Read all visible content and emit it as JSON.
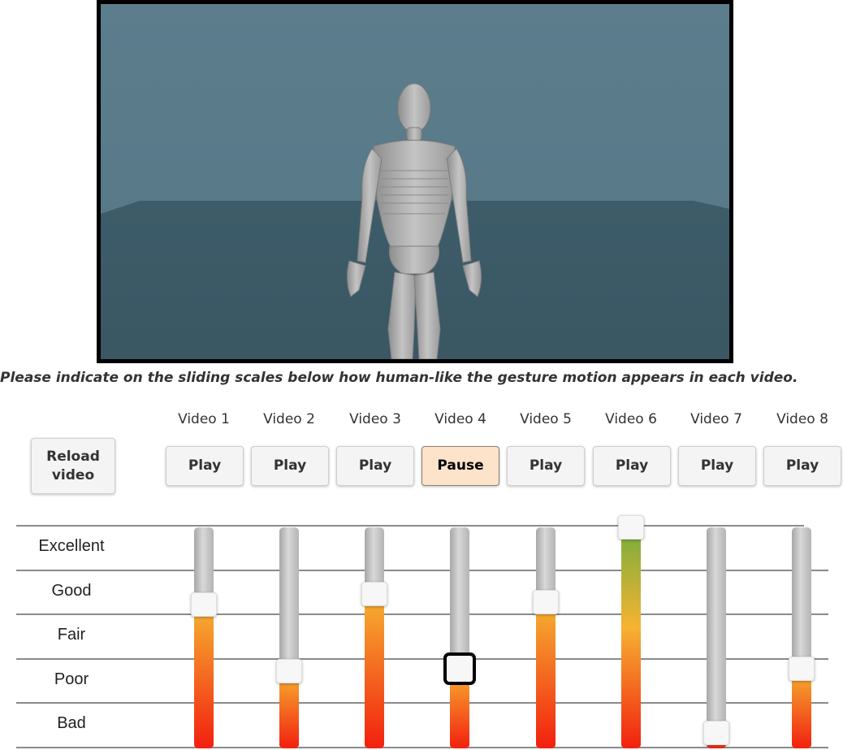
{
  "video": {
    "name": "gesture-animation-video"
  },
  "instruction": "Please indicate on the sliding scales below how human-like the gesture motion appears in each video.",
  "reload_label": "Reload video",
  "videos": [
    {
      "label": "Video 1",
      "button": "Play",
      "rating": 0.65
    },
    {
      "label": "Video 2",
      "button": "Play",
      "rating": 0.35
    },
    {
      "label": "Video 3",
      "button": "Play",
      "rating": 0.7
    },
    {
      "label": "Video 4",
      "button": "Pause",
      "rating": 0.36
    },
    {
      "label": "Video 5",
      "button": "Play",
      "rating": 0.66
    },
    {
      "label": "Video 6",
      "button": "Play",
      "rating": 1.0
    },
    {
      "label": "Video 7",
      "button": "Play",
      "rating": 0.07
    },
    {
      "label": "Video 8",
      "button": "Play",
      "rating": 0.36
    }
  ],
  "scale_labels": [
    "Excellent",
    "Good",
    "Fair",
    "Poor",
    "Bad"
  ],
  "colors": {
    "active_button": "#fde3c9",
    "fill_top": "#f6b332",
    "fill_bottom": "#f2200f",
    "fill_excellent": "#76ad3d",
    "background_wall": "#587b8a",
    "background_floor": "#3c5a67"
  }
}
